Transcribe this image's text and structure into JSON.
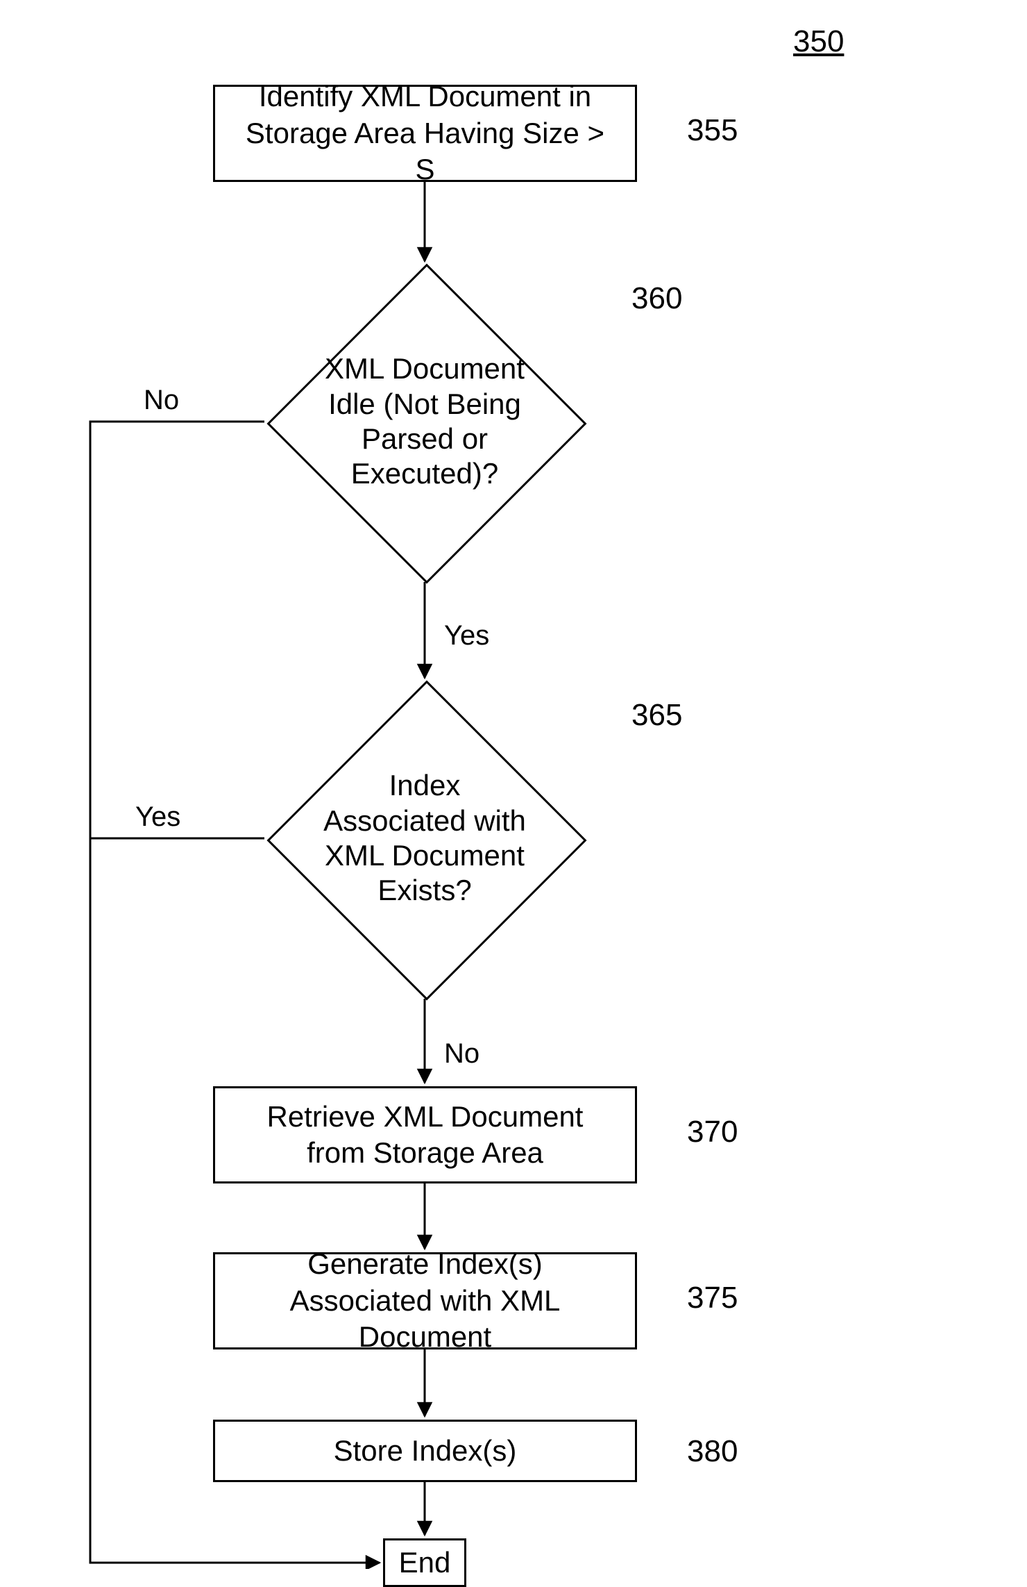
{
  "flowchart": {
    "figure_number": "350",
    "steps": {
      "s355": {
        "num": "355",
        "text": "Identify XML Document in Storage Area Having Size > S"
      },
      "s360": {
        "num": "360",
        "text": "XML Document Idle (Not Being Parsed or Executed)?"
      },
      "s365": {
        "num": "365",
        "text": "Index Associated with XML Document Exists?"
      },
      "s370": {
        "num": "370",
        "text": "Retrieve XML Document from Storage Area"
      },
      "s375": {
        "num": "375",
        "text": "Generate Index(s) Associated with XML Document"
      },
      "s380": {
        "num": "380",
        "text": "Store Index(s)"
      },
      "end": {
        "text": "End"
      }
    },
    "edge_labels": {
      "d360_no": "No",
      "d360_yes": "Yes",
      "d365_yes": "Yes",
      "d365_no": "No"
    }
  }
}
